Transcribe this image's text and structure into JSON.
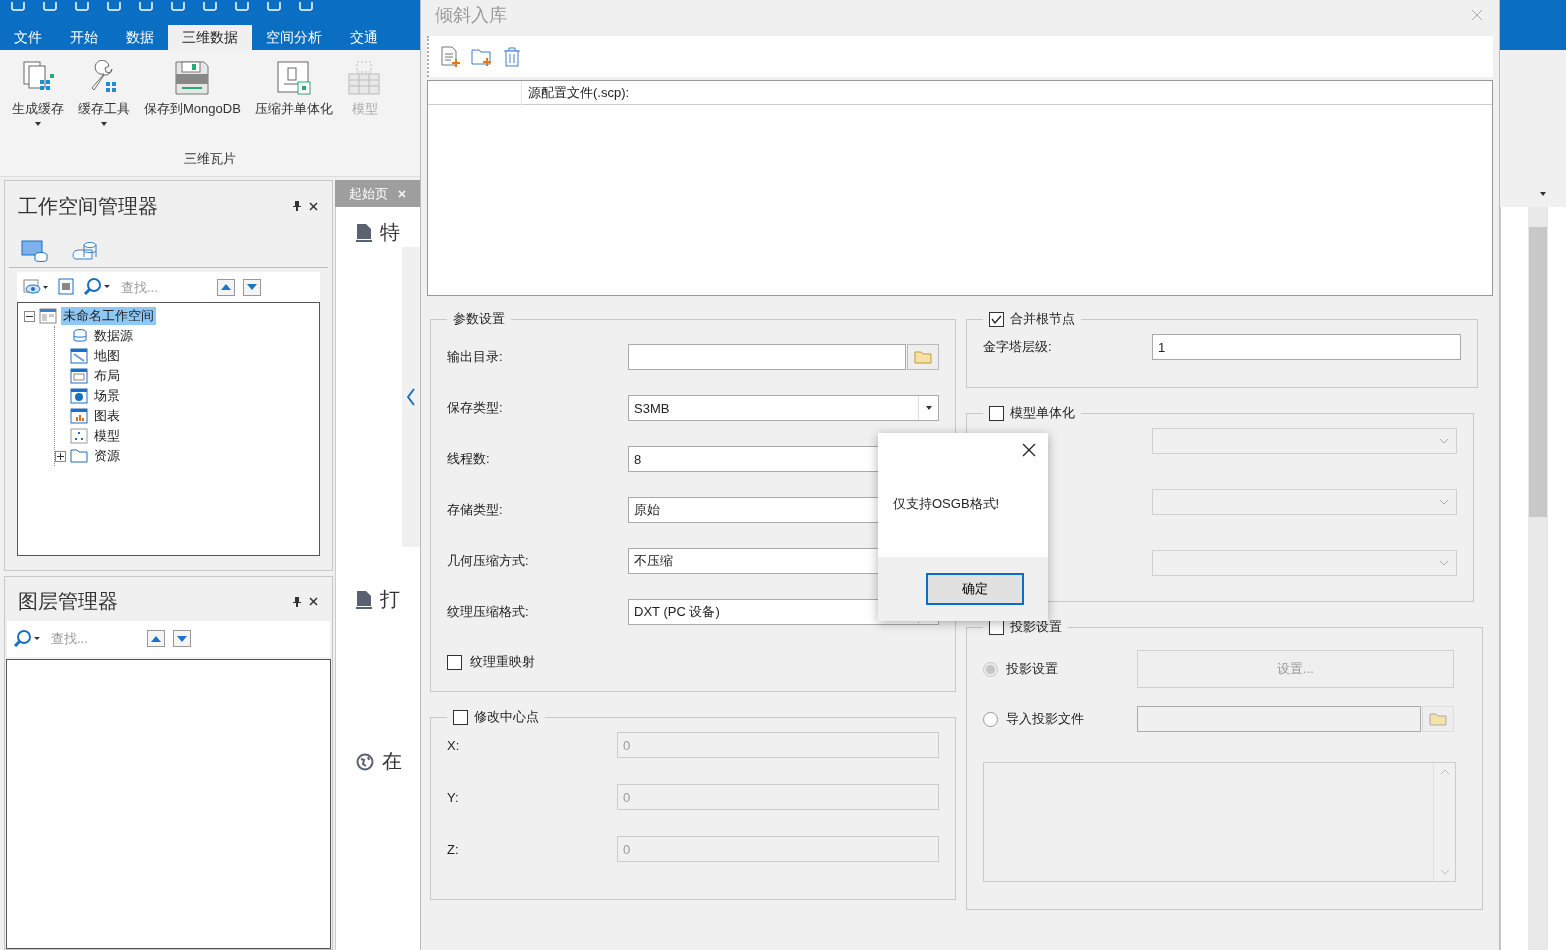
{
  "ribbon": {
    "tabs": [
      {
        "label": "文件",
        "selected": false
      },
      {
        "label": "开始",
        "selected": false
      },
      {
        "label": "数据",
        "selected": false
      },
      {
        "label": "三维数据",
        "selected": true
      },
      {
        "label": "空间分析",
        "selected": false
      },
      {
        "label": "交通",
        "selected": false
      }
    ],
    "group": {
      "label": "三维瓦片",
      "buttons": [
        {
          "kind": "cache",
          "label": "生成缓存",
          "dropdown": true,
          "disabled": false
        },
        {
          "kind": "tool",
          "label": "缓存工具",
          "dropdown": true,
          "disabled": false
        },
        {
          "kind": "mongo",
          "label": "保存到MongoDB",
          "dropdown": false,
          "disabled": false
        },
        {
          "kind": "compress",
          "label": "压缩并单体化",
          "dropdown": false,
          "disabled": false
        },
        {
          "kind": "model",
          "label": "模型",
          "dropdown": false,
          "disabled": true
        }
      ]
    }
  },
  "workspace_panel": {
    "title": "工作空间管理器",
    "search": {
      "placeholder": "查找..."
    },
    "tree": [
      {
        "kind": "workspace",
        "label": "未命名工作空间",
        "selected": true,
        "expanded": true,
        "children": [
          {
            "kind": "datasource",
            "label": "数据源",
            "selected": false
          },
          {
            "kind": "map",
            "label": "地图",
            "selected": false
          },
          {
            "kind": "layout",
            "label": "布局",
            "selected": false
          },
          {
            "kind": "scene",
            "label": "场景",
            "selected": false
          },
          {
            "kind": "chart",
            "label": "图表",
            "selected": false
          },
          {
            "kind": "model",
            "label": "模型",
            "selected": false
          },
          {
            "kind": "folder",
            "label": "资源",
            "selected": false,
            "expanded": false
          }
        ]
      }
    ]
  },
  "layer_panel": {
    "title": "图层管理器",
    "search": {
      "placeholder": "查找..."
    }
  },
  "document_tabs": [
    {
      "label": "起始页",
      "selected": true
    }
  ],
  "start_page": {
    "items": [
      {
        "kind": "file",
        "label": "特"
      },
      {
        "kind": "file",
        "label": "打"
      },
      {
        "kind": "globe",
        "label": "在"
      }
    ]
  },
  "dialog": {
    "title": "倾斜入库",
    "source_table": {
      "columns": [
        "源配置文件(.scp):"
      ]
    },
    "params": {
      "title": "参数设置",
      "fields": [
        {
          "kind": "path",
          "label": "输出目录:"
        },
        {
          "kind": "combo",
          "label": "保存类型:",
          "value": "S3MB"
        },
        {
          "kind": "text",
          "label": "线程数:",
          "value": "8"
        },
        {
          "kind": "combo",
          "label": "存储类型:",
          "value": "原始"
        },
        {
          "kind": "combo",
          "label": "几何压缩方式:",
          "value": "不压缩"
        },
        {
          "kind": "combo",
          "label": "纹理压缩格式:",
          "value": "DXT (PC 设备)"
        }
      ],
      "remap_texture": {
        "label": "纹理重映射",
        "checked": false
      }
    },
    "center": {
      "label": "修改中心点",
      "checked": false,
      "fields": [
        {
          "label": "X:",
          "value": "0"
        },
        {
          "label": "Y:",
          "value": "0"
        },
        {
          "label": "Z:",
          "value": "0"
        }
      ]
    },
    "merge_root": {
      "label": "合并根节点",
      "checked": true,
      "fields": [
        {
          "label": "金字塔层级:",
          "value": "1"
        }
      ]
    },
    "model_split": {
      "label": "模型单体化",
      "checked": false,
      "fields": [
        {
          "disabled": true
        },
        {
          "disabled": true
        },
        {
          "disabled": true
        }
      ]
    },
    "projection": {
      "label": "投影设置",
      "checked": false,
      "options": [
        {
          "label": "投影设置",
          "selected": true,
          "disabled": true
        },
        {
          "label": "导入投影文件",
          "selected": false,
          "disabled": false
        }
      ],
      "button": "设置..."
    }
  },
  "message": {
    "text": "仅支持OSGB格式!",
    "button": "确定"
  }
}
